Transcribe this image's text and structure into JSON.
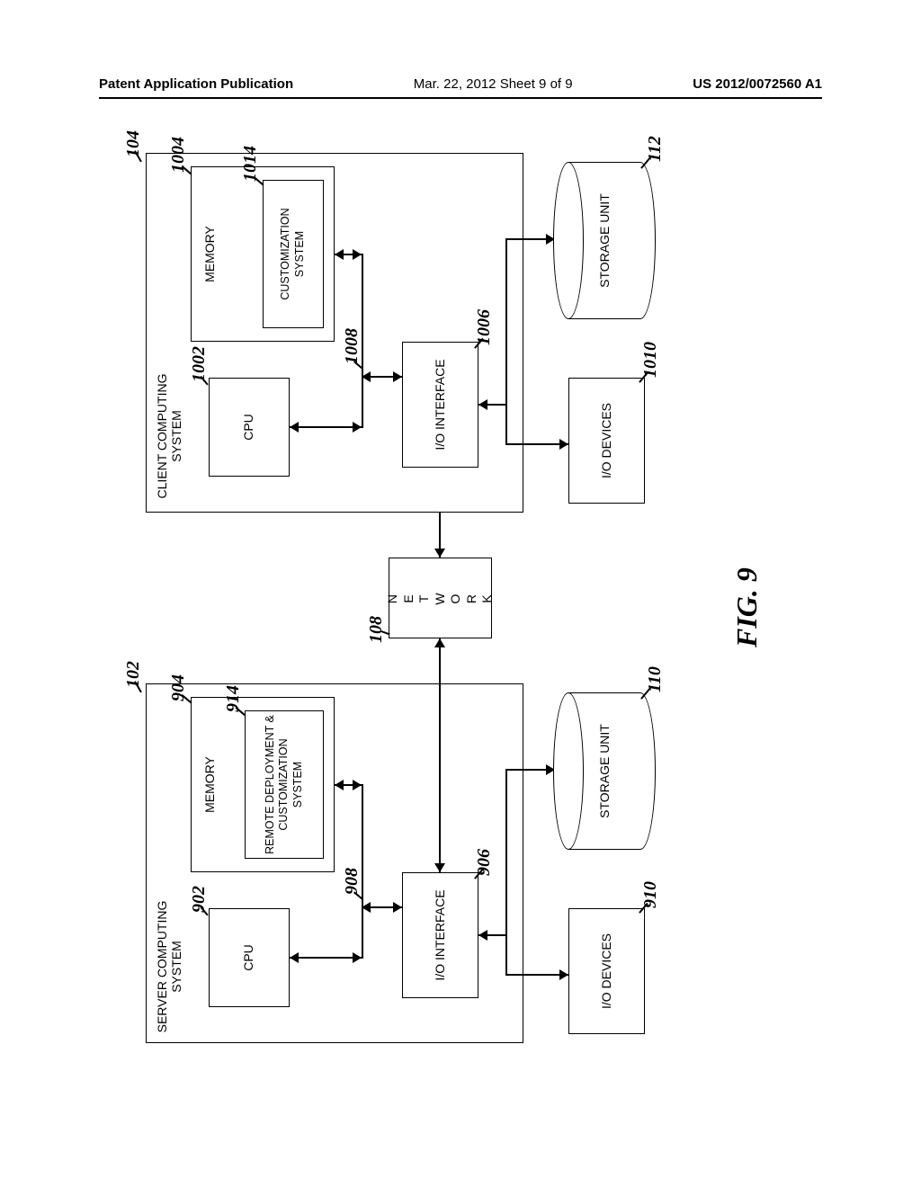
{
  "header": {
    "left": "Patent Application Publication",
    "center": "Mar. 22, 2012  Sheet 9 of 9",
    "right": "US 2012/0072560 A1"
  },
  "figure": {
    "caption": "FIG. 9",
    "server": {
      "title": "SERVER COMPUTING SYSTEM",
      "ref": "102",
      "cpu": {
        "label": "CPU",
        "ref": "902"
      },
      "memory": {
        "label": "MEMORY",
        "ref": "904"
      },
      "subsystem": {
        "label": "REMOTE DEPLOYMENT & CUSTOMIZATION SYSTEM",
        "ref": "914"
      },
      "bus_ref": "908",
      "io_interface": {
        "label": "I/O INTERFACE",
        "ref": "906"
      },
      "io_devices": {
        "label": "I/O DEVICES",
        "ref": "910"
      },
      "storage": {
        "label": "STORAGE UNIT",
        "ref": "110"
      }
    },
    "network": {
      "label": "NETWORK",
      "ref": "108"
    },
    "client": {
      "title": "CLIENT COMPUTING SYSTEM",
      "ref": "104",
      "cpu": {
        "label": "CPU",
        "ref": "1002"
      },
      "memory": {
        "label": "MEMORY",
        "ref": "1004"
      },
      "subsystem": {
        "label": "CUSTOMIZATION SYSTEM",
        "ref": "1014"
      },
      "bus_ref": "1008",
      "io_interface": {
        "label": "I/O INTERFACE",
        "ref": "1006"
      },
      "io_devices": {
        "label": "I/O DEVICES",
        "ref": "1010"
      },
      "storage": {
        "label": "STORAGE UNIT",
        "ref": "112"
      }
    }
  }
}
